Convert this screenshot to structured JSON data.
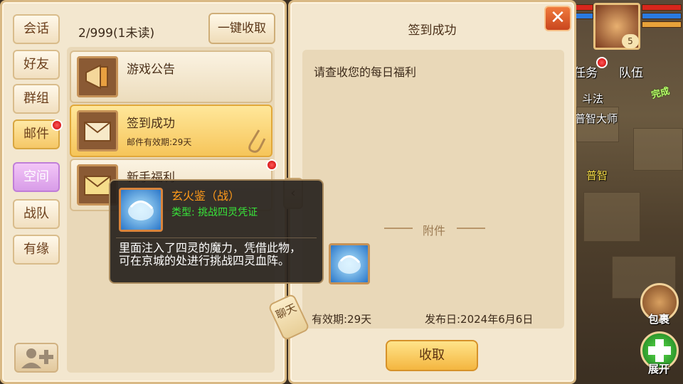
{
  "nav": {
    "tabs": [
      {
        "label": "会话"
      },
      {
        "label": "好友"
      },
      {
        "label": "群组"
      },
      {
        "label": "邮件"
      },
      {
        "label": "空间"
      },
      {
        "label": "战队"
      },
      {
        "label": "有缘"
      }
    ],
    "add_friend_icon": "add-friend-icon"
  },
  "mail": {
    "count_text": "2/999(1未读)",
    "collect_all_label": "一键收取",
    "items": [
      {
        "title": "游戏公告",
        "subtitle": "",
        "icon": "megaphone-icon"
      },
      {
        "title": "签到成功",
        "subtitle": "邮件有效期:29天",
        "icon": "envelope-open-icon"
      },
      {
        "title": "新手福利",
        "subtitle": "",
        "icon": "envelope-icon"
      }
    ]
  },
  "tooltip": {
    "name": "玄火鉴（战）",
    "type_text": "类型: 挑战四灵凭证",
    "description": "里面注入了四灵的魔力，凭借此物，可在京城的处进行挑战四灵血阵。"
  },
  "detail": {
    "title": "签到成功",
    "body": "请查收您的每日福利",
    "attachment_label": "附件",
    "valid_text": "有效期:29天",
    "publish_text": "发布日:2024年6月6日",
    "collect_label": "收取",
    "chat_tag": "聊天"
  },
  "hud": {
    "level": "5",
    "quest_label": "任务",
    "team_label": "队伍",
    "battle_text": "斗法",
    "npc_name": "普智大师",
    "npc2_name": "普智",
    "done_badge": "完成",
    "bag_label": "包裹",
    "expand_label": "展开"
  },
  "colors": {
    "accent_orange": "#ff9a1a",
    "type_green": "#38e63a",
    "unread_dot": "#e00000"
  }
}
